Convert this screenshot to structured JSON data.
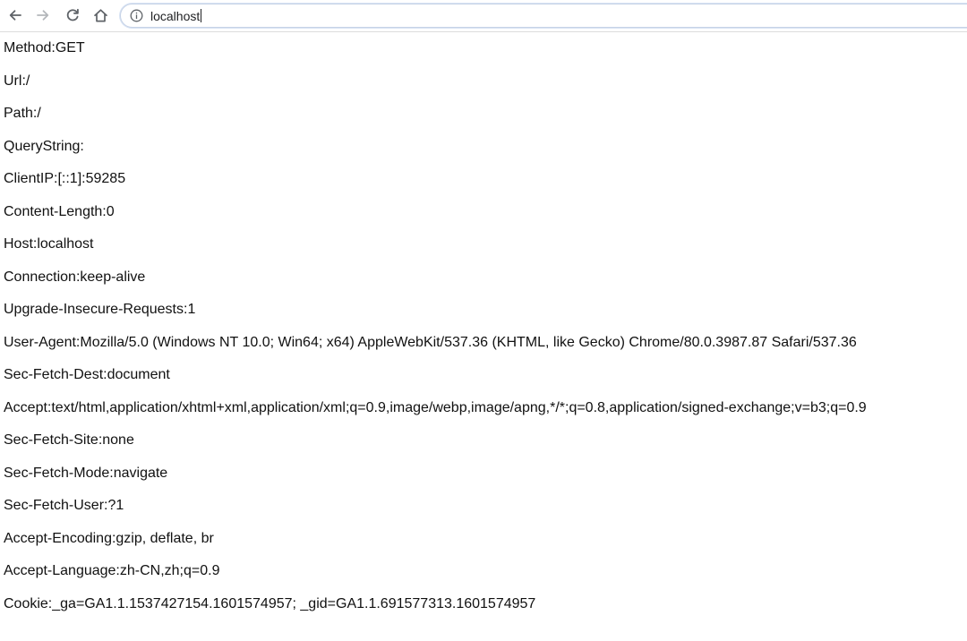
{
  "browser": {
    "url": "localhost",
    "icons": {
      "back": "arrow-left-icon",
      "forward": "arrow-right-icon",
      "reload": "reload-icon",
      "home": "home-icon",
      "site_info": "info-icon"
    }
  },
  "request_info": [
    "Method:GET",
    "Url:/",
    "Path:/",
    "QueryString:",
    "ClientIP:[::1]:59285",
    "Content-Length:0",
    "Host:localhost",
    "Connection:keep-alive",
    "Upgrade-Insecure-Requests:1",
    "User-Agent:Mozilla/5.0 (Windows NT 10.0; Win64; x64) AppleWebKit/537.36 (KHTML, like Gecko) Chrome/80.0.3987.87 Safari/537.36",
    "Sec-Fetch-Dest:document",
    "Accept:text/html,application/xhtml+xml,application/xml;q=0.9,image/webp,image/apng,*/*;q=0.8,application/signed-exchange;v=b3;q=0.9",
    "Sec-Fetch-Site:none",
    "Sec-Fetch-Mode:navigate",
    "Sec-Fetch-User:?1",
    "Accept-Encoding:gzip, deflate, br",
    "Accept-Language:zh-CN,zh;q=0.9",
    "Cookie:_ga=GA1.1.1537427154.1601574957; _gid=GA1.1.691577313.1601574957"
  ]
}
